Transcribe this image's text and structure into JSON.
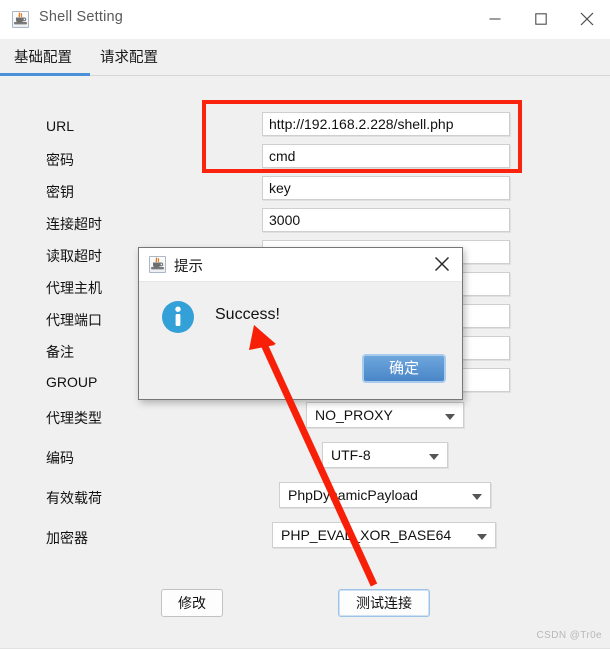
{
  "window": {
    "title": "Shell Setting",
    "icon": "java-icon",
    "controls": {
      "minimize": "minimize-icon",
      "maximize": "maximize-icon",
      "close": "close-icon"
    }
  },
  "tabs": [
    {
      "label": "基础配置",
      "active": true
    },
    {
      "label": "请求配置",
      "active": false
    }
  ],
  "form": {
    "rows": [
      {
        "label": "URL",
        "value": "http://192.168.2.228/shell.php",
        "type": "text"
      },
      {
        "label": "密码",
        "value": "cmd",
        "type": "text"
      },
      {
        "label": "密钥",
        "value": "key",
        "type": "text"
      },
      {
        "label": "连接超时",
        "value": "3000",
        "type": "text"
      },
      {
        "label": "读取超时",
        "value": "",
        "type": "text"
      },
      {
        "label": "代理主机",
        "value": "",
        "type": "text"
      },
      {
        "label": "代理端口",
        "value": "",
        "type": "text"
      },
      {
        "label": "备注",
        "value": "",
        "type": "text"
      },
      {
        "label": "GROUP",
        "value": "/",
        "type": "text"
      },
      {
        "label": "代理类型",
        "value": "NO_PROXY",
        "type": "combo"
      },
      {
        "label": "编码",
        "value": "UTF-8",
        "type": "combo"
      },
      {
        "label": "有效载荷",
        "value": "PhpDynamicPayload",
        "type": "combo"
      },
      {
        "label": "加密器",
        "value": "PHP_EVAL_XOR_BASE64",
        "type": "combo"
      }
    ]
  },
  "actions": {
    "modify": "修改",
    "test_connection": "测试连接"
  },
  "dialog": {
    "title": "提示",
    "icon": "java-icon",
    "info_icon": "info-icon",
    "close_icon": "close-icon",
    "message": "Success!",
    "ok_label": "确定"
  },
  "annotations": {
    "highlight_color": "#fa230d",
    "arrow_color": "#f81f09"
  },
  "watermark": "CSDN @Tr0e"
}
